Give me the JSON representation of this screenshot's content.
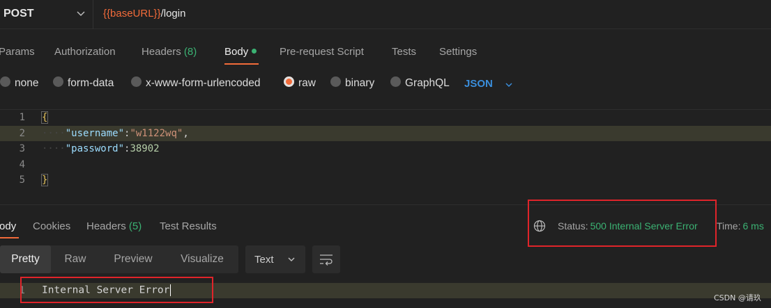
{
  "request": {
    "method": "POST",
    "url_variable": "{{baseURL}}",
    "url_path": "/login"
  },
  "request_tabs": [
    {
      "label": "Params"
    },
    {
      "label": "Authorization"
    },
    {
      "label": "Headers",
      "count": "(8)"
    },
    {
      "label": "Body"
    },
    {
      "label": "Pre-request Script"
    },
    {
      "label": "Tests"
    },
    {
      "label": "Settings"
    }
  ],
  "body_types": [
    {
      "label": "none"
    },
    {
      "label": "form-data"
    },
    {
      "label": "x-www-form-urlencoded"
    },
    {
      "label": "raw",
      "selected": true
    },
    {
      "label": "binary"
    },
    {
      "label": "GraphQL"
    }
  ],
  "raw_language": "JSON",
  "editor": {
    "line_numbers": [
      "1",
      "2",
      "3",
      "4",
      "5"
    ],
    "open_brace": "{",
    "close_brace": "}",
    "username_key": "\"username\"",
    "username_value": "\"w1122wq\"",
    "password_key": "\"password\"",
    "password_value": "38902"
  },
  "response_tabs": [
    {
      "label": "Body"
    },
    {
      "label": "Cookies"
    },
    {
      "label": "Headers",
      "count": "(5)"
    },
    {
      "label": "Test Results"
    }
  ],
  "status": {
    "label": "Status:",
    "value": "500 Internal Server Error",
    "color": "#3bb273"
  },
  "time": {
    "label": "Time:",
    "value": "6 ms"
  },
  "view_modes": [
    {
      "label": "Pretty",
      "active": true
    },
    {
      "label": "Raw"
    },
    {
      "label": "Preview"
    },
    {
      "label": "Visualize"
    }
  ],
  "format": "Text",
  "response_body": {
    "line_number": "1",
    "text": "Internal Server Error"
  },
  "watermark": "CSDN @请玖",
  "colors": {
    "accent": "#f26b3a",
    "success": "#3bb273",
    "link": "#3a8edc",
    "annotation": "#e0242a"
  }
}
